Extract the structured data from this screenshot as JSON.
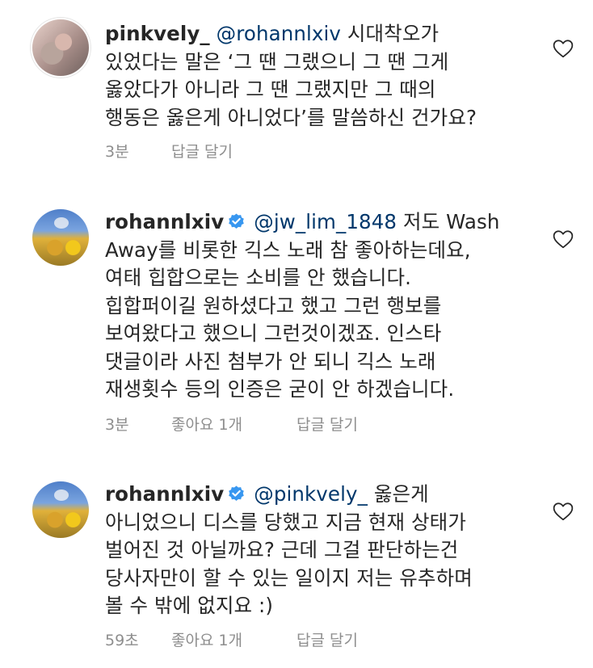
{
  "comments": [
    {
      "username": "pinkvely_",
      "verified": false,
      "mention": "@rohannlxiv",
      "lines": [
        " 시대착오가",
        "있었다는 말은 ‘그 땐 그랬으니 그 땐 그게",
        "옳았다가 아니라 그 땐 그랬지만 그 때의",
        "행동은 옳은게 아니었다’를 말씀하신 건가요?"
      ],
      "time": "3분",
      "likes": "",
      "reply": "답글 달기",
      "avatar_icon": "profile-photo"
    },
    {
      "username": "rohannlxiv",
      "verified": true,
      "mention": "@jw_lim_1848",
      "lines": [
        " 저도 Wash",
        "Away를 비롯한 긱스 노래 참 좋아하는데요,",
        "여태 힙합으로는 소비를 안 했습니다.",
        "힙합퍼이길 원하셨다고 했고 그런 행보를",
        "보여왔다고 했으니 그런것이겠죠. 인스타",
        "댓글이라 사진 첨부가 안 되니 긱스 노래",
        "재생횟수 등의 인증은 굳이 안 하겠습니다."
      ],
      "time": "3분",
      "likes": "좋아요 1개",
      "reply": "답글 달기",
      "avatar_icon": "sunflower-field-photo"
    },
    {
      "username": "rohannlxiv",
      "verified": true,
      "mention": "@pinkvely_",
      "lines": [
        " 옳은게",
        "아니었으니 디스를 당했고 지금 현재 상태가",
        "벌어진 것 아닐까요? 근데 그걸 판단하는건",
        "당사자만이 할 수 있는 일이지 저는 유추하며",
        "볼 수 밖에 없지요 :)"
      ],
      "time": "59초",
      "likes": "좋아요 1개",
      "reply": "답글 달기",
      "avatar_icon": "sunflower-field-photo"
    }
  ],
  "colors": {
    "text": "#262626",
    "mention": "#00376b",
    "meta": "#8e8e8e",
    "verified": "#3897f0"
  },
  "icons": {
    "like": "heart-outline-icon",
    "verified": "verified-badge-icon"
  }
}
